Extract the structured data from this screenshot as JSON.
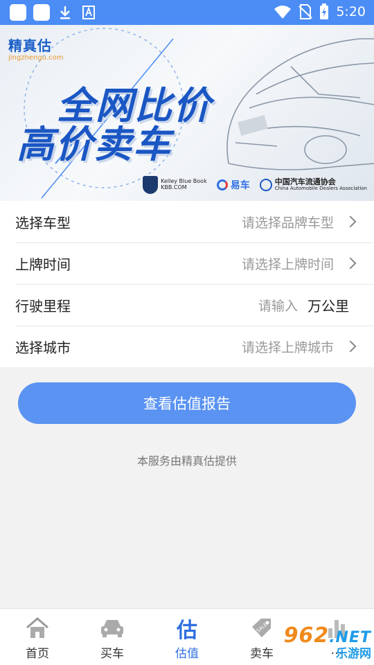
{
  "status_bar": {
    "time": "5:20",
    "icons": [
      "app-square-icon",
      "app-square-icon",
      "download-icon",
      "text-icon",
      "wifi-icon",
      "no-sim-icon",
      "battery-charging-icon"
    ]
  },
  "banner": {
    "brand_cn": "精真估",
    "brand_en": "jingzhengu.com",
    "headline_1": "全网比价",
    "headline_2": "高价卖车",
    "partner_kbb_1": "Kelley Blue Book",
    "partner_kbb_2": "KBB.COM",
    "partner_yiche": "易车",
    "partner_cada": "中国汽车流通协会",
    "partner_cada_en": "China Automobile Dealers Association"
  },
  "form": {
    "rows": [
      {
        "label": "选择车型",
        "value": "请选择品牌车型"
      },
      {
        "label": "上牌时间",
        "value": "请选择上牌时间"
      },
      {
        "label": "行驶里程",
        "value": "请输入",
        "unit": "万公里"
      },
      {
        "label": "选择城市",
        "value": "请选择上牌城市"
      }
    ],
    "submit_label": "查看估值报告",
    "footnote": "本服务由精真估提供"
  },
  "tabs": [
    {
      "label": "首页",
      "icon": "home-icon"
    },
    {
      "label": "买车",
      "icon": "car-icon"
    },
    {
      "label": "估值",
      "icon": "estimate-icon",
      "glyph": "估",
      "active": true
    },
    {
      "label": "卖车",
      "icon": "sale-tag-icon"
    },
    {
      "label": "…",
      "icon": "chart-icon"
    }
  ],
  "watermark": {
    "number": "962",
    "suffix": ".NET",
    "text": "乐游网"
  },
  "colors": {
    "primary": "#4b8cf5",
    "button": "#5a93f2",
    "active_tab": "#2f6fe0"
  }
}
